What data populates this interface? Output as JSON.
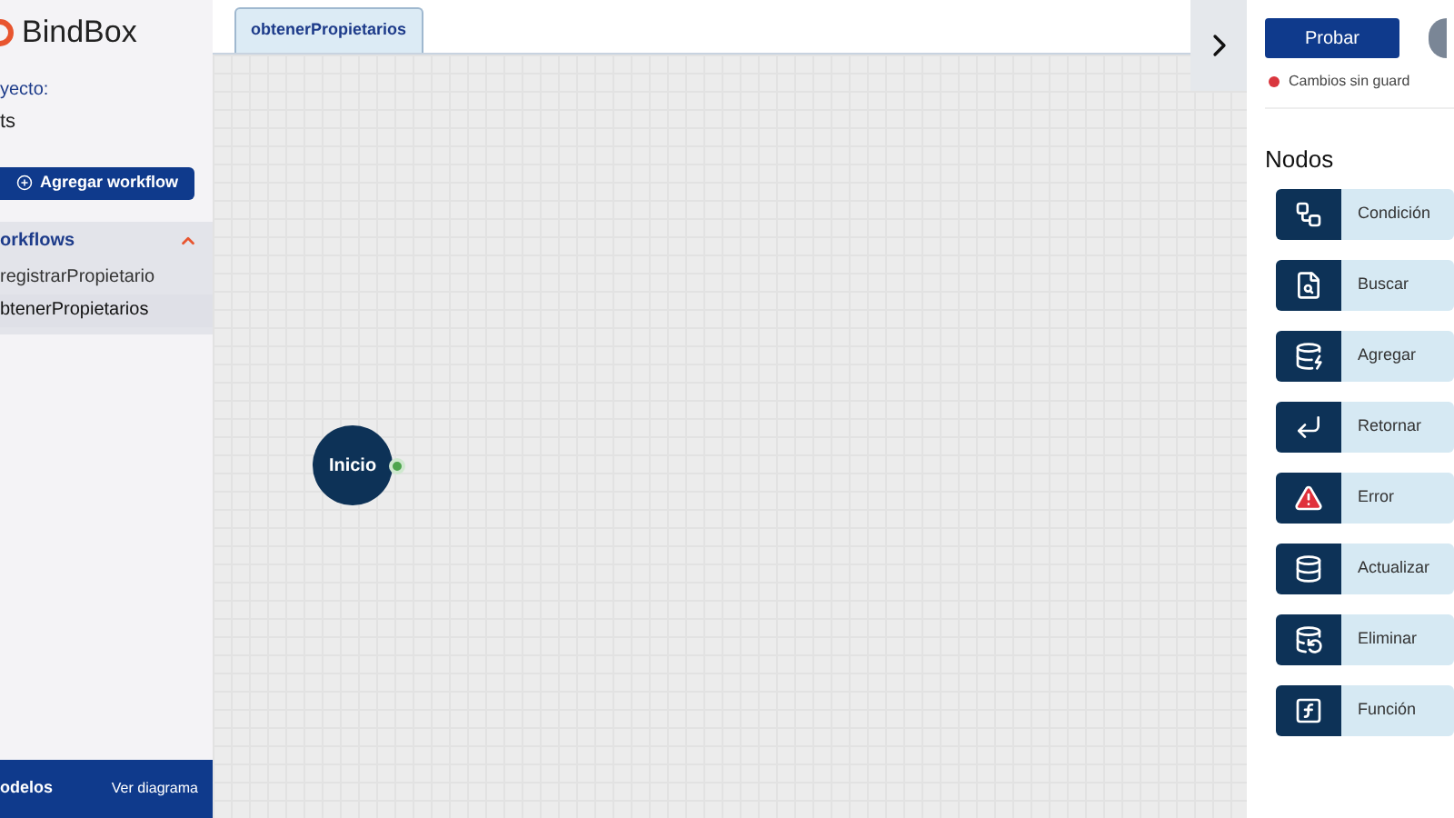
{
  "sidebar": {
    "brand": "BindBox",
    "project_label": "yecto:",
    "project_name": "ts",
    "add_button": "Agregar workflow",
    "section": {
      "title": "orkflows",
      "expanded": true
    },
    "workflows": [
      {
        "label": "registrarPropietario",
        "selected": false
      },
      {
        "label": "btenerPropietarios",
        "selected": true
      }
    ],
    "footer": {
      "title": "odelos",
      "link": "Ver diagrama"
    }
  },
  "tabs": [
    {
      "label": "obtenerPropietarios",
      "selected": true
    }
  ],
  "canvas": {
    "nodes": [
      {
        "label": "Inicio"
      }
    ]
  },
  "panel": {
    "run_button": "Probar",
    "status": "Cambios sin guard",
    "title": "Nodos",
    "nodes": [
      {
        "kind": "condition",
        "label": "Condición"
      },
      {
        "kind": "search",
        "label": "Buscar"
      },
      {
        "kind": "insert",
        "label": "Agregar"
      },
      {
        "kind": "return",
        "label": "Retornar"
      },
      {
        "kind": "error",
        "label": "Error"
      },
      {
        "kind": "update",
        "label": "Actualizar"
      },
      {
        "kind": "delete",
        "label": "Eliminar"
      },
      {
        "kind": "function",
        "label": "Función"
      }
    ]
  }
}
